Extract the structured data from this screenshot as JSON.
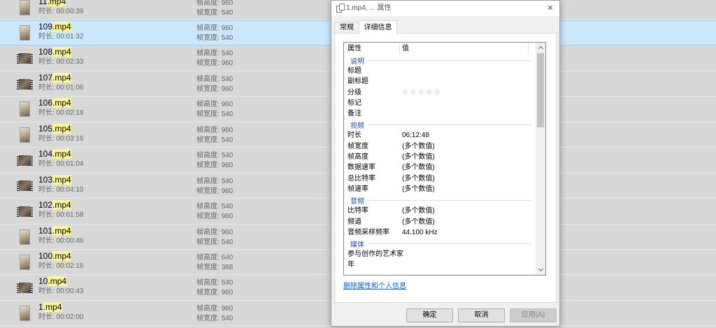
{
  "colors": {
    "selection": "#cce8ff",
    "search_highlight": "#fbf59b",
    "group_title": "#1f4f9c",
    "link": "#0066cc"
  },
  "file_list": {
    "selected_index": 1,
    "labels": {
      "duration": "时长:",
      "frame_height": "帧高度:",
      "frame_width": "帧宽度:"
    },
    "items": [
      {
        "name": "11",
        "ext": ".mp4",
        "duration": "00:00:39",
        "frame_height": "960",
        "frame_width": "540",
        "thumbnail": "portrait"
      },
      {
        "name": "109",
        "ext": ".mp4",
        "duration": "00:01:32",
        "frame_height": "960",
        "frame_width": "540",
        "thumbnail": "portrait"
      },
      {
        "name": "108",
        "ext": ".mp4",
        "duration": "00:02:33",
        "frame_height": "540",
        "frame_width": "960",
        "thumbnail": "landscape"
      },
      {
        "name": "107",
        "ext": ".mp4",
        "duration": "00:01:06",
        "frame_height": "540",
        "frame_width": "960",
        "thumbnail": "landscape"
      },
      {
        "name": "106",
        "ext": ".mp4",
        "duration": "00:02:18",
        "frame_height": "960",
        "frame_width": "540",
        "thumbnail": "portrait"
      },
      {
        "name": "105",
        "ext": ".mp4",
        "duration": "00:03:16",
        "frame_height": "960",
        "frame_width": "540",
        "thumbnail": "portrait"
      },
      {
        "name": "104",
        "ext": ".mp4",
        "duration": "00:01:04",
        "frame_height": "540",
        "frame_width": "960",
        "thumbnail": "landscape"
      },
      {
        "name": "103",
        "ext": ".mp4",
        "duration": "00:04:10",
        "frame_height": "540",
        "frame_width": "960",
        "thumbnail": "landscape"
      },
      {
        "name": "102",
        "ext": ".mp4",
        "duration": "00:01:58",
        "frame_height": "540",
        "frame_width": "960",
        "thumbnail": "landscape"
      },
      {
        "name": "101",
        "ext": ".mp4",
        "duration": "00:00:46",
        "frame_height": "960",
        "frame_width": "540",
        "thumbnail": "portrait"
      },
      {
        "name": "100",
        "ext": ".mp4",
        "duration": "00:02:16",
        "frame_height": "640",
        "frame_width": "368",
        "thumbnail": "portrait"
      },
      {
        "name": "10",
        "ext": ".mp4",
        "duration": "00:00:43",
        "frame_height": "540",
        "frame_width": "960",
        "thumbnail": "landscape"
      },
      {
        "name": "1",
        "ext": ".mp4",
        "duration": "00:02:00",
        "frame_height": "960",
        "frame_width": "540",
        "thumbnail": "portrait"
      }
    ]
  },
  "dialog": {
    "icon": "file-properties-icon",
    "close_icon": "close-icon",
    "title": "1.mp4, ... 属性",
    "tabs": [
      {
        "label": "常规",
        "active": false
      },
      {
        "label": "详细信息",
        "active": true
      }
    ],
    "details": {
      "header": {
        "property": "属性",
        "value": "值"
      },
      "groups": [
        {
          "title": "说明",
          "rows": [
            {
              "label": "标题"
            },
            {
              "label": "副标题"
            },
            {
              "label": "分级",
              "rating": 0,
              "rating_max": 5
            },
            {
              "label": "标记"
            },
            {
              "label": "备注"
            }
          ]
        },
        {
          "title": "视频",
          "rows": [
            {
              "label": "时长",
              "value": "06:12:48"
            },
            {
              "label": "帧宽度",
              "value": "(多个数值)"
            },
            {
              "label": "帧高度",
              "value": "(多个数值)"
            },
            {
              "label": "数据速率",
              "value": "(多个数值)"
            },
            {
              "label": "总比特率",
              "value": "(多个数值)"
            },
            {
              "label": "帧速率",
              "value": "(多个数值)"
            }
          ]
        },
        {
          "title": "音频",
          "rows": [
            {
              "label": "比特率",
              "value": "(多个数值)"
            },
            {
              "label": "频道",
              "value": "(多个数值)"
            },
            {
              "label": "音频采样频率",
              "value": "44.100 kHz"
            }
          ]
        },
        {
          "title": "媒体",
          "rows": [
            {
              "label": "参与创作的艺术家"
            },
            {
              "label": "年"
            }
          ]
        }
      ],
      "scrollbar": {
        "scroll_position": 0,
        "visible_fraction": 0.35
      }
    },
    "remove_link": "删除属性和个人信息",
    "buttons": {
      "ok": "确定",
      "cancel": "取消",
      "apply": "应用(A)",
      "apply_enabled": false
    }
  }
}
